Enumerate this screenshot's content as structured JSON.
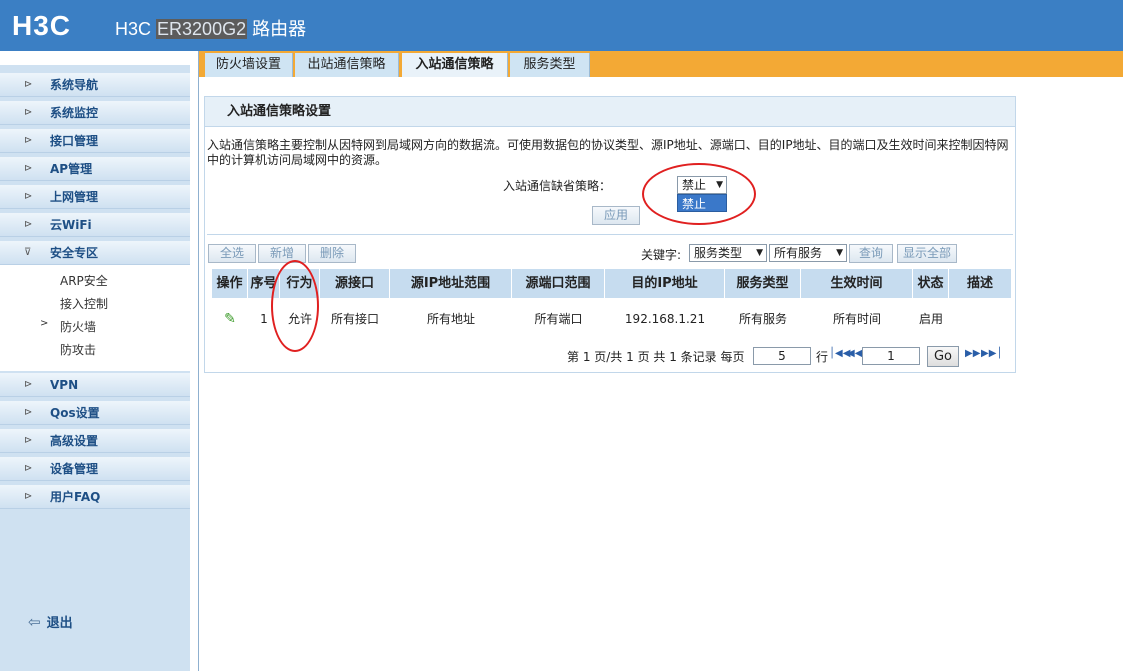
{
  "header": {
    "logo": "H3C",
    "brand": "H3C",
    "model": "ER3200G2",
    "product": "路由器"
  },
  "tabs": [
    {
      "label": "防火墙设置"
    },
    {
      "label": "出站通信策略"
    },
    {
      "label": "入站通信策略",
      "active": true
    },
    {
      "label": "服务类型"
    }
  ],
  "sidebar": {
    "items": [
      {
        "label": "系统导航"
      },
      {
        "label": "系统监控"
      },
      {
        "label": "接口管理"
      },
      {
        "label": "AP管理"
      },
      {
        "label": "上网管理"
      },
      {
        "label": "云WiFi"
      },
      {
        "label": "安全专区",
        "expanded": true
      },
      {
        "label": "VPN"
      },
      {
        "label": "Qos设置"
      },
      {
        "label": "高级设置"
      },
      {
        "label": "设备管理"
      },
      {
        "label": "用户FAQ"
      }
    ],
    "sub_items": [
      {
        "label": "ARP安全"
      },
      {
        "label": "接入控制"
      },
      {
        "label": "防火墙",
        "active": true
      },
      {
        "label": "防攻击"
      }
    ],
    "logout": "退出"
  },
  "panel": {
    "title": "入站通信策略设置",
    "description": "入站通信策略主要控制从因特网到局域网方向的数据流。可使用数据包的协议类型、源IP地址、源端口、目的IP地址、目的端口及生效时间来控制因特网中的计算机访问局域网中的资源。",
    "default_policy_label": "入站通信缺省策略：",
    "default_policy_value": "禁止",
    "dropdown_open_option": "禁止",
    "apply_button": "应用"
  },
  "toolbar": {
    "select_all": "全选",
    "add": "新增",
    "delete": "删除",
    "keyword_label": "关键字:",
    "keyword_type": "服务类型",
    "keyword_value": "所有服务",
    "search": "查询",
    "show_all": "显示全部"
  },
  "table": {
    "headers": [
      "操作",
      "序号",
      "行为",
      "源接口",
      "源IP地址范围",
      "源端口范围",
      "目的IP地址",
      "服务类型",
      "生效时间",
      "状态",
      "描述"
    ],
    "rows": [
      {
        "index": "1",
        "action": "允许",
        "src_if": "所有接口",
        "src_ip": "所有地址",
        "src_port": "所有端口",
        "dst_ip": "192.168.1.21",
        "service": "所有服务",
        "time": "所有时间",
        "status": "启用",
        "desc": ""
      }
    ]
  },
  "pager": {
    "text": "第 1 页/共 1 页 共 1 条记录 每页",
    "per_page": "5",
    "row_label": "行",
    "page": "1",
    "go": "Go"
  },
  "icons": {
    "edit": "pencil-icon",
    "first": "first-page-icon",
    "prev": "prev-page-icon",
    "next": "next-page-icon",
    "last": "last-page-icon",
    "logout": "logout-icon"
  },
  "colors": {
    "header": "#3b7fc4",
    "tabbar": "#f3a935",
    "sidebar": "#cfe1f1",
    "annotation": "#e02020"
  }
}
